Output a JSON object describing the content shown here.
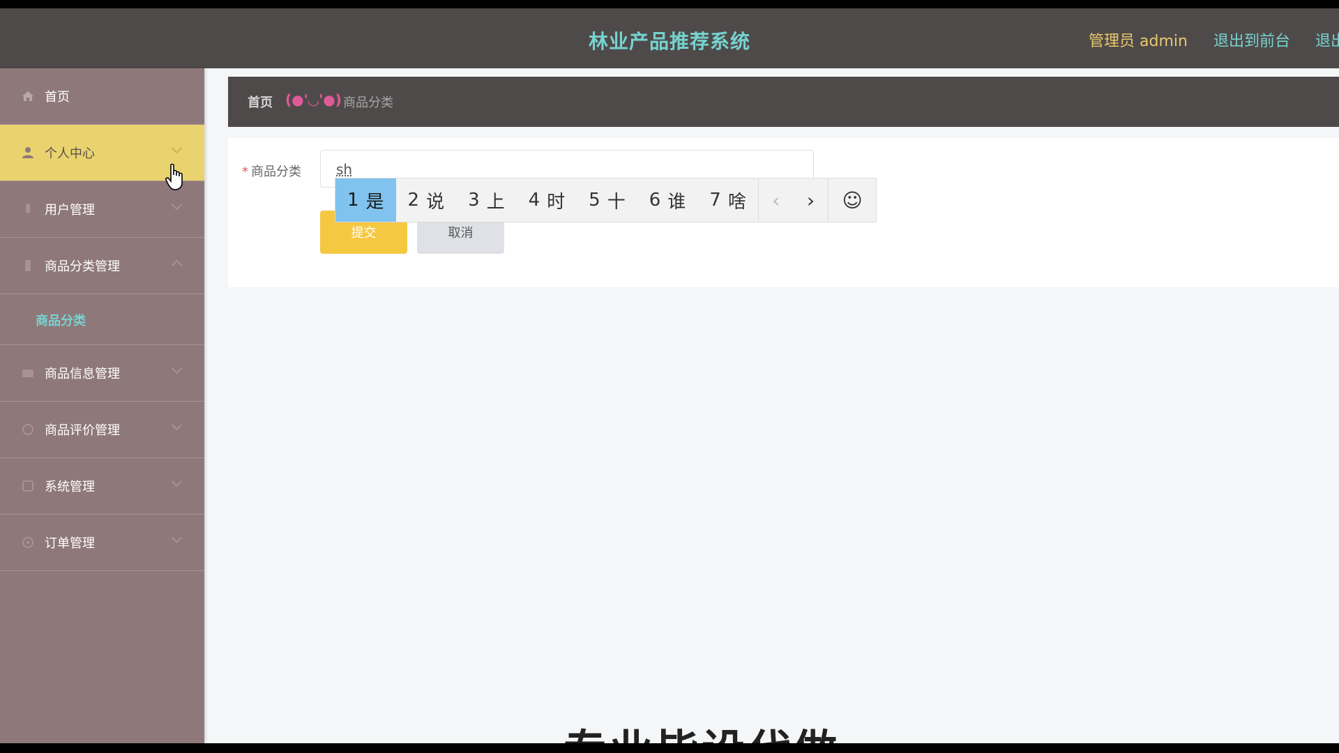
{
  "header": {
    "title": "林业产品推荐系统",
    "admin_label": "管理员 admin",
    "front_link": "退出到前台",
    "logout_link": "退出登录"
  },
  "sidebar": {
    "items": [
      {
        "label": "首页",
        "icon": "home-icon"
      },
      {
        "label": "个人中心",
        "icon": "user-icon",
        "active": true
      },
      {
        "label": "用户管理",
        "icon": "users-icon"
      },
      {
        "label": "商品分类管理",
        "icon": "category-icon",
        "children": [
          "商品分类"
        ]
      },
      {
        "label": "商品信息管理",
        "icon": "goods-icon"
      },
      {
        "label": "商品评价管理",
        "icon": "comment-icon"
      },
      {
        "label": "系统管理",
        "icon": "system-icon"
      },
      {
        "label": "订单管理",
        "icon": "order-icon"
      }
    ]
  },
  "breadcrumb": {
    "home": "首页",
    "separator": "(●'◡'●)",
    "current": "商品分类"
  },
  "form": {
    "label": "商品分类",
    "required_mark": "*",
    "value": "sh",
    "submit": "提交",
    "cancel": "取消"
  },
  "ime": {
    "candidates": [
      {
        "num": "1",
        "text": "是"
      },
      {
        "num": "2",
        "text": "说"
      },
      {
        "num": "3",
        "text": "上"
      },
      {
        "num": "4",
        "text": "时"
      },
      {
        "num": "5",
        "text": "十"
      },
      {
        "num": "6",
        "text": "谁"
      },
      {
        "num": "7",
        "text": "啥"
      }
    ],
    "prev": "‹",
    "next": "›",
    "emoji": "☺"
  },
  "watermark": "专业毕设代做",
  "colors": {
    "header_bg": "#4f4a4a",
    "sidebar_bg": "#8f787a",
    "accent_teal": "#76d3cf",
    "active_yellow": "#e9d36e",
    "submit_yellow": "#f5c842"
  }
}
